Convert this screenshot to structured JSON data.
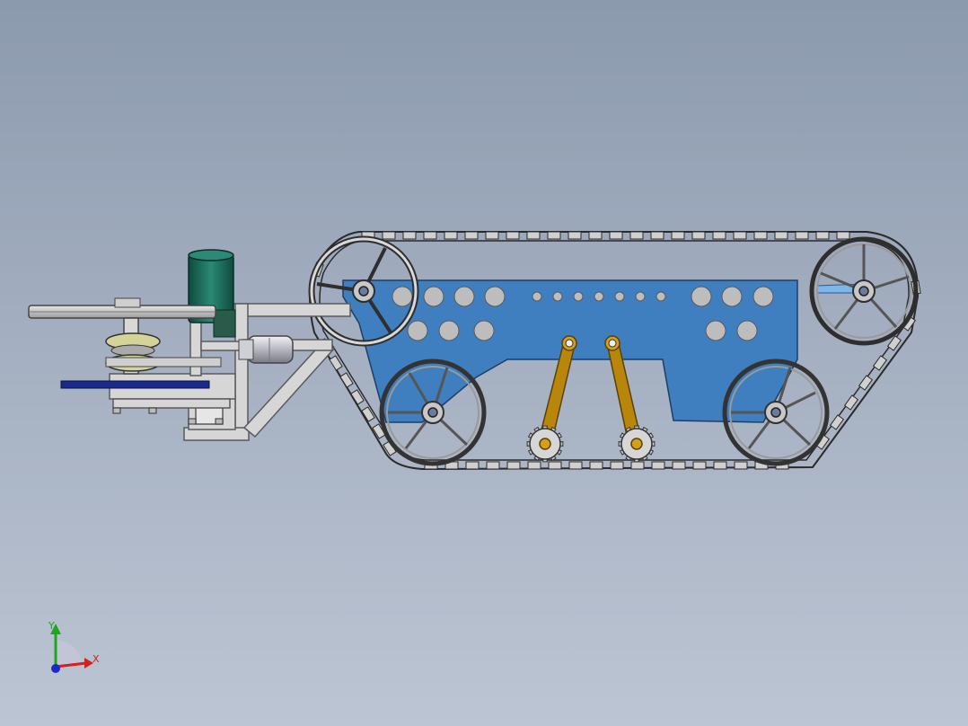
{
  "triad": {
    "y_label": "Y",
    "x_label": "X",
    "y_color": "#1fa51f",
    "x_color": "#d42020",
    "z_color": "#1a2cc8"
  },
  "colors": {
    "background_top": "#8c9aae",
    "background_bottom": "#bcc5d3",
    "chassis_plate": "#3f7fbf",
    "track": "#cfcfcf",
    "wheel": "#c8c8c8",
    "swing_arm": "#b8860b",
    "motor": "#1e6b5c",
    "frame": "#d6d6d6",
    "base_plate": "#1a2a8c"
  },
  "icons": [
    "track-link-icon",
    "road-wheel-icon",
    "sprocket-icon",
    "motor-icon",
    "coordinate-triad-icon"
  ]
}
